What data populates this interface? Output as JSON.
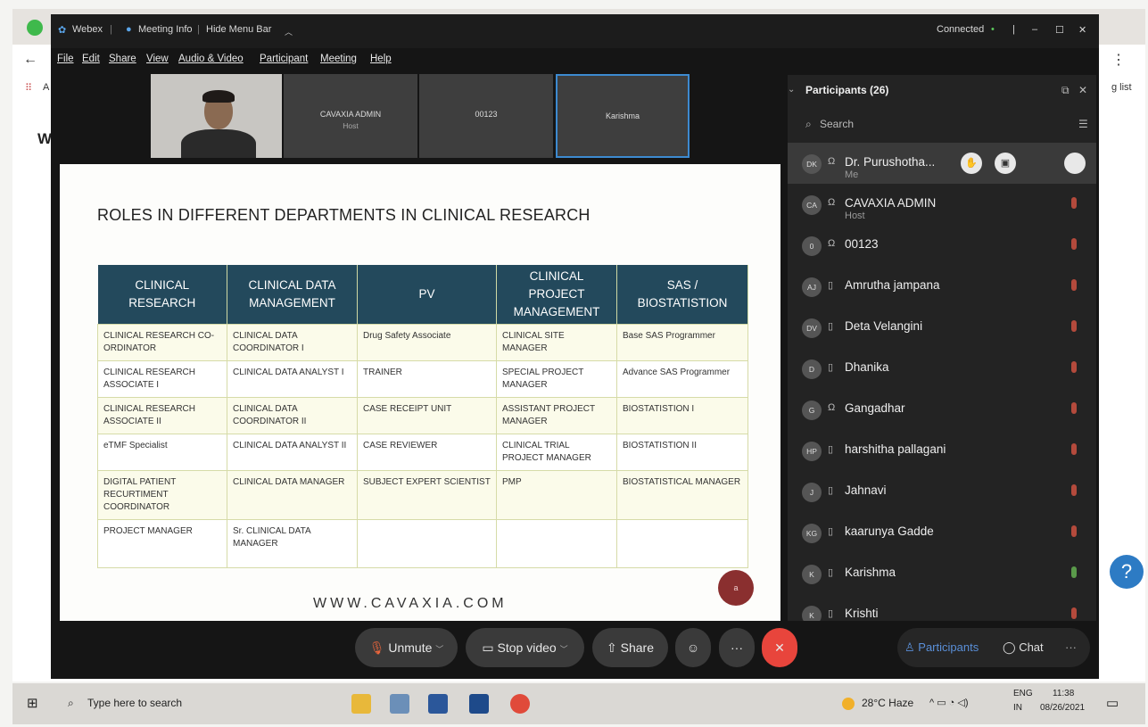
{
  "browser": {
    "back": "←",
    "menu": "⋮",
    "apps_glyph": "⠿",
    "apps_letter": "A",
    "reading_list": "g list",
    "partial_letter": "W"
  },
  "titlebar": {
    "app": "Webex",
    "meeting_info": "Meeting Info",
    "hide_menu": "Hide Menu Bar",
    "status": "Connected",
    "status_color": "#5cc85c"
  },
  "menu": [
    "File",
    "Edit",
    "Share",
    "View",
    "Audio & Video",
    "Participant",
    "Meeting",
    "Help"
  ],
  "thumbnails": [
    {
      "name": "",
      "role": ""
    },
    {
      "name": "CAVAXIA ADMIN",
      "role": "Host"
    },
    {
      "name": "00123",
      "role": ""
    },
    {
      "name": "Karishma",
      "role": ""
    }
  ],
  "slide": {
    "title": "ROLES IN DIFFERENT DEPARTMENTS IN CLINICAL RESEARCH",
    "headers": [
      "CLINICAL RESEARCH",
      "CLINICAL DATA MANAGEMENT",
      "PV",
      "CLINICAL PROJECT MANAGEMENT",
      "SAS / BIOSTATISTION"
    ],
    "rows": [
      [
        "CLINICAL RESEARCH CO-ORDINATOR",
        "CLINICAL DATA COORDINATOR I",
        "Drug Safety Associate",
        "CLINICAL SITE MANAGER",
        "Base SAS Programmer"
      ],
      [
        "CLINICAL RESEARCH ASSOCIATE I",
        "CLINICAL DATA ANALYST I",
        "TRAINER",
        "SPECIAL PROJECT MANAGER",
        "Advance SAS Programmer"
      ],
      [
        "CLINICAL RESEARCH ASSOCIATE II",
        "CLINICAL DATA COORDINATOR II",
        "CASE RECEIPT UNIT",
        "ASSISTANT PROJECT MANAGER",
        "BIOSTATISTION I"
      ],
      [
        "eTMF Specialist",
        "CLINICAL DATA ANALYST II",
        "CASE REVIEWER",
        "CLINICAL TRIAL PROJECT MANAGER",
        "BIOSTATISTION II"
      ],
      [
        "DIGITAL PATIENT RECURTIMENT COORDINATOR",
        "CLINICAL DATA MANAGER",
        "SUBJECT EXPERT SCIENTIST",
        "PMP",
        "BIOSTATISTICAL MANAGER"
      ],
      [
        "PROJECT MANAGER",
        "Sr. CLINICAL DATA MANAGER",
        "",
        "",
        ""
      ]
    ],
    "footer": "WWW.CAVAXIA.COM",
    "badge": "a"
  },
  "panel": {
    "title": "Participants (26)",
    "search_placeholder": "Search",
    "participants": [
      {
        "initials": "DK",
        "name": "Dr. Purushotha...",
        "role": "Me",
        "mic_on": false
      },
      {
        "initials": "CA",
        "name": "CAVAXIA ADMIN",
        "role": "Host",
        "mic_on": false
      },
      {
        "initials": "0",
        "name": "00123",
        "role": "",
        "mic_on": false
      },
      {
        "initials": "AJ",
        "name": "Amrutha jampana",
        "role": "",
        "mic_on": false
      },
      {
        "initials": "DV",
        "name": "Deta Velangini",
        "role": "",
        "mic_on": false
      },
      {
        "initials": "D",
        "name": "Dhanika",
        "role": "",
        "mic_on": false
      },
      {
        "initials": "G",
        "name": "Gangadhar",
        "role": "",
        "mic_on": false
      },
      {
        "initials": "HP",
        "name": "harshitha pallagani",
        "role": "",
        "mic_on": false
      },
      {
        "initials": "J",
        "name": "Jahnavi",
        "role": "",
        "mic_on": false
      },
      {
        "initials": "KG",
        "name": "kaarunya Gadde",
        "role": "",
        "mic_on": false
      },
      {
        "initials": "K",
        "name": "Karishma",
        "role": "",
        "mic_on": true
      },
      {
        "initials": "K",
        "name": "Krishti",
        "role": "",
        "mic_on": false
      }
    ]
  },
  "controls": {
    "unmute": "Unmute",
    "stop_video": "Stop video",
    "share": "Share",
    "participants": "Participants",
    "chat": "Chat"
  },
  "taskbar": {
    "search": "Type here to search",
    "weather": "28°C Haze",
    "lang": "ENG",
    "region": "IN",
    "time": "11:38",
    "date": "08/26/2021"
  }
}
